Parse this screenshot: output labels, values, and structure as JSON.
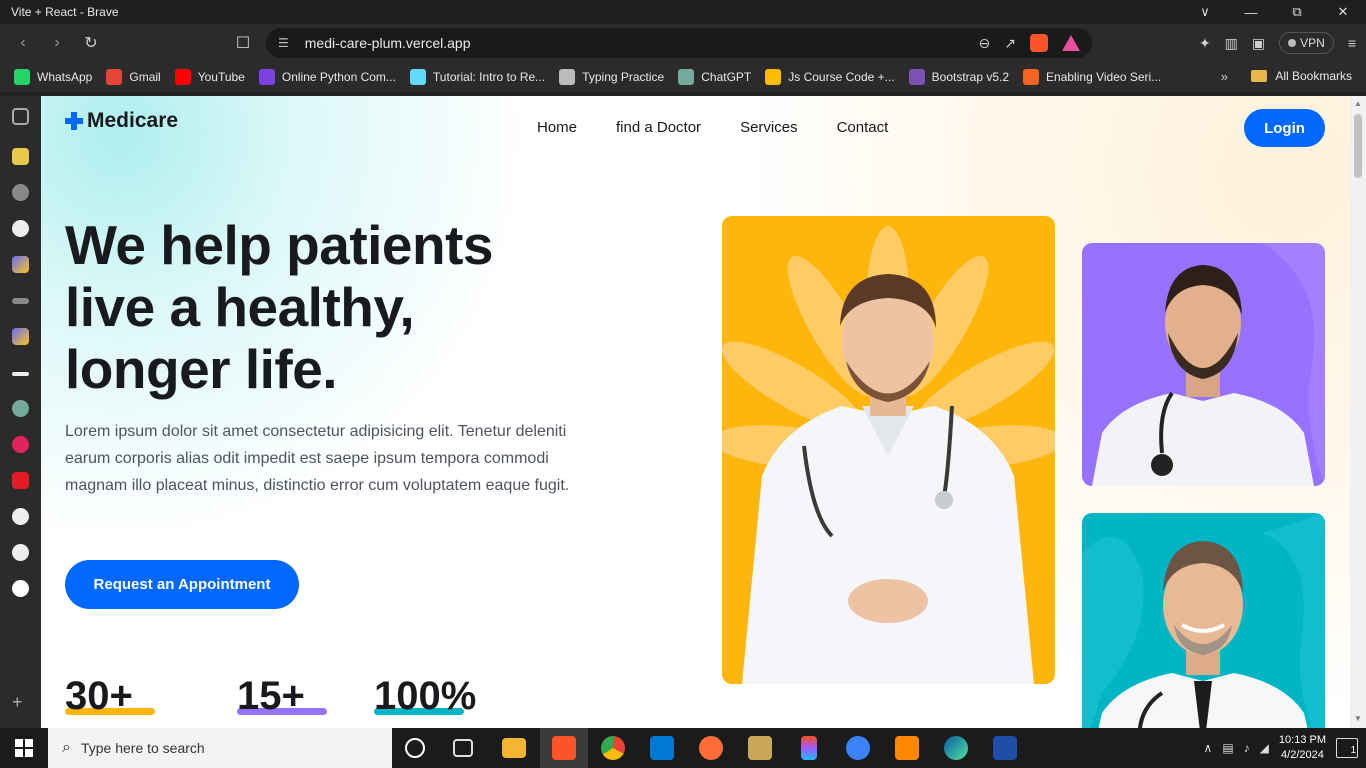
{
  "window": {
    "title": "Vite + React - Brave",
    "minimize": "∨",
    "restore": "—",
    "maximize": "⧉",
    "close": "✕"
  },
  "browser": {
    "url": "medi-care-plum.vercel.app",
    "vpn_label": "VPN",
    "bookmarks": [
      {
        "label": "WhatsApp",
        "color": "#25d366"
      },
      {
        "label": "Gmail",
        "color": "#ea4335"
      },
      {
        "label": "YouTube",
        "color": "#ff0000"
      },
      {
        "label": "Online Python Com...",
        "color": "#7b3fe4"
      },
      {
        "label": "Tutorial: Intro to Re...",
        "color": "#61dafb"
      },
      {
        "label": "Typing Practice",
        "color": "#bbbbbb"
      },
      {
        "label": "ChatGPT",
        "color": "#74aa9c"
      },
      {
        "label": "Js Course Code +...",
        "color": "#fbbc04"
      },
      {
        "label": "Bootstrap v5.2",
        "color": "#7952b3"
      },
      {
        "label": "Enabling Video Seri...",
        "color": "#f26522"
      }
    ],
    "bookmarks_more": "»",
    "all_bookmarks": "All Bookmarks"
  },
  "site": {
    "brand": "Medicare",
    "nav": [
      "Home",
      "find a Doctor",
      "Services",
      "Contact"
    ],
    "login_label": "Login",
    "hero": {
      "title_line1": "We help patients",
      "title_line2": "live a healthy,",
      "title_line3": "longer life.",
      "description": "Lorem ipsum dolor sit amet consectetur adipisicing elit. Tenetur deleniti earum corporis alias odit impedit est saepe ipsum tempora commodi magnam illo placeat minus, distinctio error cum voluptatem eaque fugit.",
      "cta_label": "Request an Appointment"
    },
    "stats": [
      {
        "value": "30+",
        "color": "#feb60d"
      },
      {
        "value": "15+",
        "color": "#9771ff"
      },
      {
        "value": "100%",
        "color": "#01b5c5"
      }
    ],
    "colors": {
      "primary": "#0067ff",
      "heading": "#181a1e",
      "text": "#4e545f",
      "yellow": "#feb60d",
      "purple": "#9771ff",
      "teal": "#01b5c5"
    }
  },
  "taskbar": {
    "search_placeholder": "Type here to search",
    "time": "10:13 PM",
    "date": "4/2/2024",
    "notifications": "1"
  }
}
